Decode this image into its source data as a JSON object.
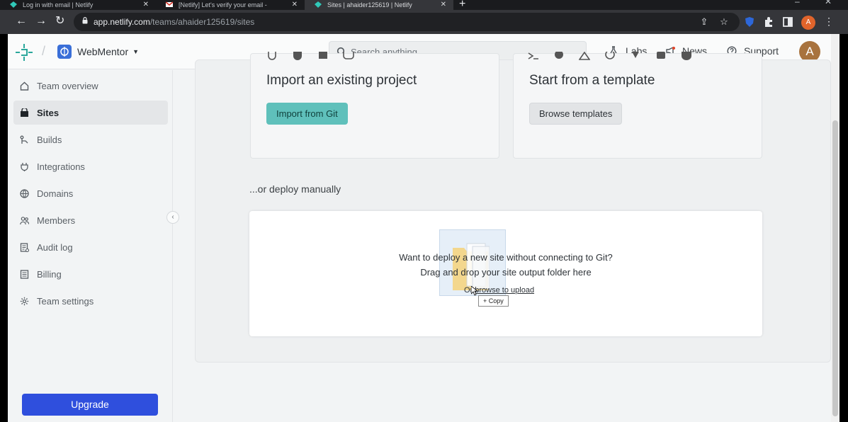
{
  "browser": {
    "tabs": [
      {
        "title": "Log in with email | Netlify",
        "active": false
      },
      {
        "title": "[Netlify] Let's verify your email -",
        "active": false
      },
      {
        "title": "Sites | ahaider125619 | Netlify",
        "active": true
      }
    ],
    "new_tab": "+",
    "url_host": "app.netlify.com",
    "url_path": "/teams/ahaider125619/sites",
    "profile_initial": "A"
  },
  "header": {
    "team_name": "WebMentor",
    "search_placeholder": "Search anything...",
    "links": [
      "Labs",
      "News",
      "Support"
    ],
    "avatar_initial": "A"
  },
  "sidebar": {
    "items": [
      {
        "label": "Team overview",
        "icon": "home-icon"
      },
      {
        "label": "Sites",
        "icon": "sites-icon"
      },
      {
        "label": "Builds",
        "icon": "builds-icon"
      },
      {
        "label": "Integrations",
        "icon": "integrations-icon"
      },
      {
        "label": "Domains",
        "icon": "globe-icon"
      },
      {
        "label": "Members",
        "icon": "members-icon"
      },
      {
        "label": "Audit log",
        "icon": "audit-log-icon"
      },
      {
        "label": "Billing",
        "icon": "billing-icon"
      },
      {
        "label": "Team settings",
        "icon": "gear-icon"
      }
    ],
    "active_item": "Sites",
    "upgrade_label": "Upgrade"
  },
  "main": {
    "import_card": {
      "title": "Import an existing project",
      "button": "Import from Git"
    },
    "template_card": {
      "title": "Start from a template",
      "button": "Browse templates"
    },
    "manual_label": "...or deploy manually",
    "dropzone": {
      "line1": "Want to deploy a new site without connecting to Git?",
      "line2": "Drag and drop your site output folder here",
      "line3_prefix": "Or ",
      "line3_link": "browse to upload",
      "drag_tooltip": "+ Copy"
    }
  },
  "colors": {
    "brand_teal": "#5fc0bb",
    "upgrade_blue": "#2f4fdd",
    "avatar_brown": "#a8733e"
  }
}
